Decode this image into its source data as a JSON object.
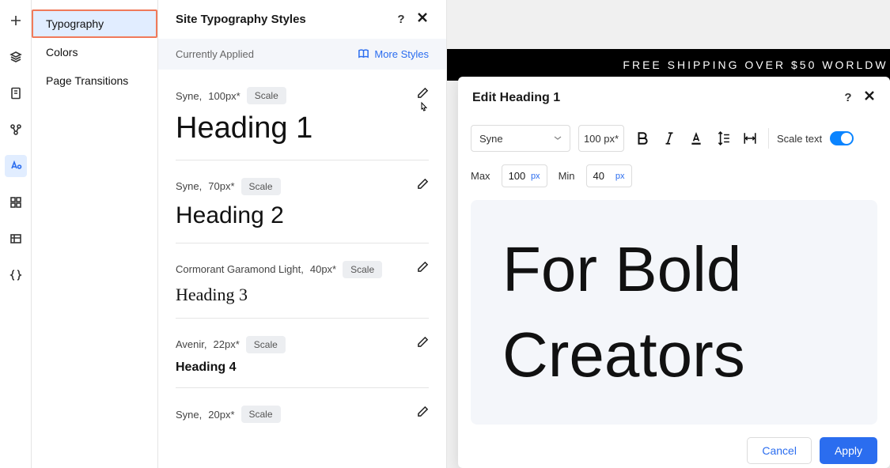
{
  "leftRail": {
    "icons": [
      "plus",
      "layers",
      "file",
      "connect",
      "typography",
      "grid",
      "table",
      "braces"
    ]
  },
  "designMenu": {
    "items": [
      {
        "label": "Typography",
        "active": true,
        "highlighted": true
      },
      {
        "label": "Colors"
      },
      {
        "label": "Page Transitions"
      }
    ]
  },
  "stylesPanel": {
    "title": "Site Typography Styles",
    "subheading": "Currently Applied",
    "moreStyles": "More Styles",
    "items": [
      {
        "font": "Syne,",
        "size": "100px*",
        "badge": "Scale",
        "preview": "Heading 1",
        "cursor": true
      },
      {
        "font": "Syne,",
        "size": "70px*",
        "badge": "Scale",
        "preview": "Heading 2"
      },
      {
        "font": "Cormorant Garamond Light,",
        "size": "40px*",
        "badge": "Scale",
        "preview": "Heading 3"
      },
      {
        "font": "Avenir,",
        "size": "22px*",
        "badge": "Scale",
        "preview": "Heading 4"
      },
      {
        "font": "Syne,",
        "size": "20px*",
        "badge": "Scale",
        "preview": ""
      }
    ]
  },
  "canvas": {
    "banner": "FREE SHIPPING OVER $50 WORLDW"
  },
  "editPanel": {
    "title": "Edit Heading 1",
    "fontSelect": "Syne",
    "sizeInput": "100 px*",
    "scaleTextLabel": "Scale text",
    "maxLabel": "Max",
    "maxValue": "100",
    "minLabel": "Min",
    "minValue": "40",
    "unit": "px",
    "previewText": "For Bold Creators",
    "cancel": "Cancel",
    "apply": "Apply"
  }
}
